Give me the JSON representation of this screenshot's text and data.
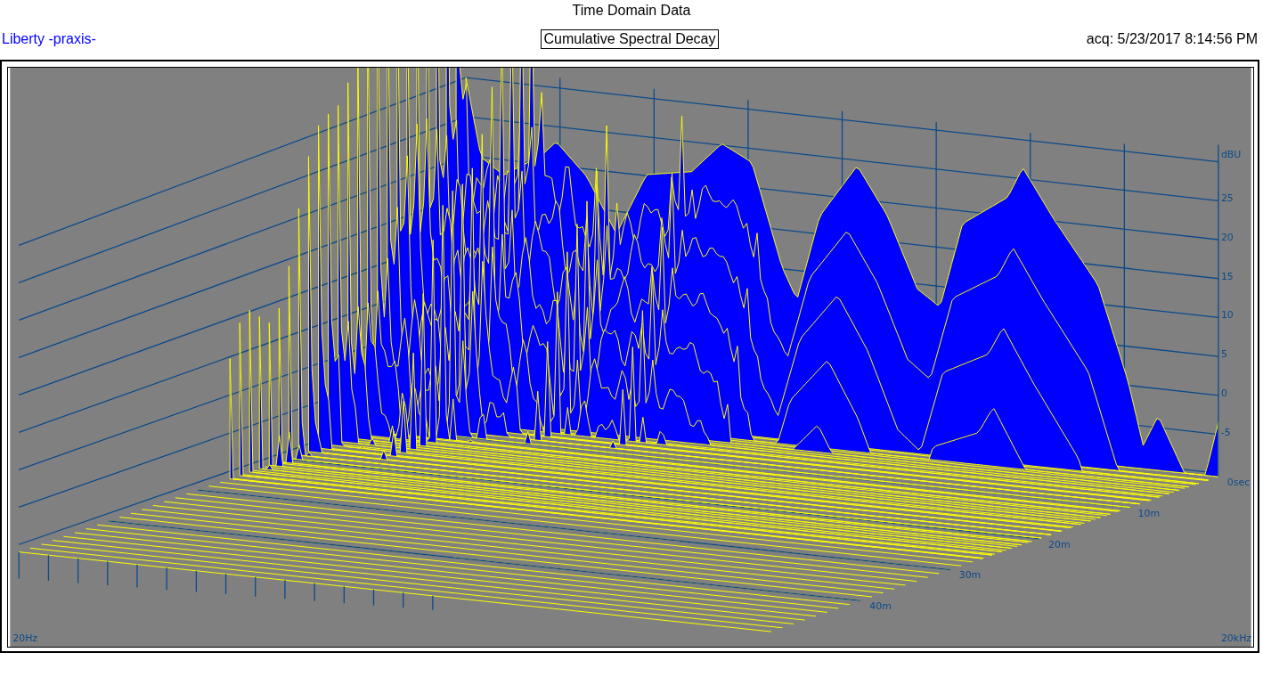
{
  "header": {
    "title": "Time Domain Data",
    "source": "Liberty -praxis-",
    "plot_name": "Cumulative Spectral Decay",
    "acquired": "acq: 5/23/2017 8:14:56 PM"
  },
  "plot": {
    "level_unit": "dBU",
    "level_ticks": [
      "25",
      "20",
      "15",
      "10",
      "5",
      "0",
      "-5"
    ],
    "time_ticks": [
      "0sec",
      "10m",
      "20m",
      "30m",
      "40m"
    ],
    "freq_start": "20Hz",
    "freq_end": "20kHz"
  }
}
